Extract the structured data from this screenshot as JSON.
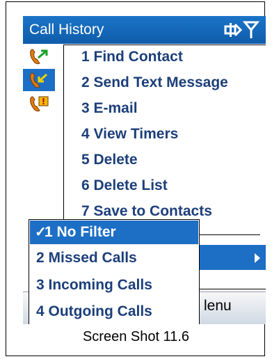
{
  "title": "Call History",
  "menu": {
    "items": [
      {
        "label": "1 Find Contact"
      },
      {
        "label": "2 Send Text Message"
      },
      {
        "label": "3 E-mail"
      },
      {
        "label": "4 View Timers"
      },
      {
        "label": "5 Delete"
      },
      {
        "label": "6 Delete List"
      },
      {
        "label": "7 Save to Contacts"
      }
    ]
  },
  "filter_submenu": {
    "items": [
      {
        "label": "1 No Filter",
        "checked": true
      },
      {
        "label": "2 Missed Calls"
      },
      {
        "label": "3 Incoming Calls"
      },
      {
        "label": "4 Outgoing Calls"
      }
    ]
  },
  "softkeys": {
    "right": "lenu"
  },
  "caption": "Screen Shot 11.6",
  "icons": {
    "call_types": [
      "outgoing-call-icon",
      "incoming-call-icon",
      "missed-call-icon"
    ],
    "status": [
      "data-connection-icon",
      "signal-icon"
    ]
  },
  "colors": {
    "accent": "#1c6fc5",
    "menu_text": "#1c3f7a"
  }
}
